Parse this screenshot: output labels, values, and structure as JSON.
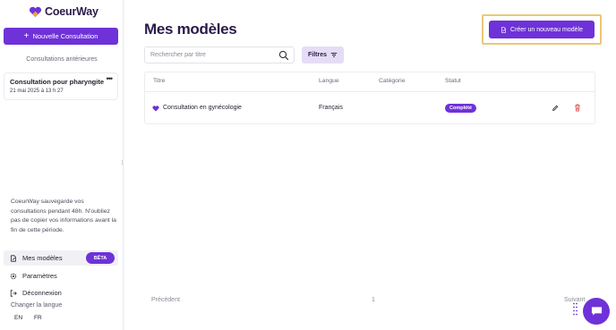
{
  "app": {
    "name": "CoeurWay",
    "brand_color": "#6e32d8",
    "highlight_color": "#e8c97a"
  },
  "sidebar": {
    "new_consultation_label": "Nouvelle Consultation",
    "previous_title": "Consultations antérieures",
    "consultations": [
      {
        "title": "Consultation pour pharyngite",
        "date": "21 mai 2025 à 13 h 27"
      }
    ],
    "info": "CoeurWay sauvegarde vos consultations pendant 48h. N'oubliez pas de copier vos informations avant la fin de cette période.",
    "nav": [
      {
        "label": "Mes modèles",
        "icon": "document-edit-icon",
        "badge": "BÊTA",
        "active": true
      },
      {
        "label": "Paramètres",
        "icon": "gear-icon"
      },
      {
        "label": "Déconnexion",
        "icon": "logout-icon"
      }
    ],
    "language": {
      "label": "Changer la langue",
      "options": [
        "EN",
        "FR"
      ]
    }
  },
  "main": {
    "title": "Mes modèles",
    "create_label": "Créer un nouveau modèle",
    "search_placeholder": "Rechercher par titre",
    "filters_label": "Filtres",
    "table": {
      "columns": [
        "Titre",
        "Langue",
        "Catégorie",
        "Statut"
      ],
      "rows": [
        {
          "title": "Consultation en gynécologie",
          "language": "Français",
          "category": "",
          "status": "Complété"
        }
      ]
    },
    "pagination": {
      "prev": "Précédent",
      "page": "1",
      "next": "Suivant"
    }
  }
}
